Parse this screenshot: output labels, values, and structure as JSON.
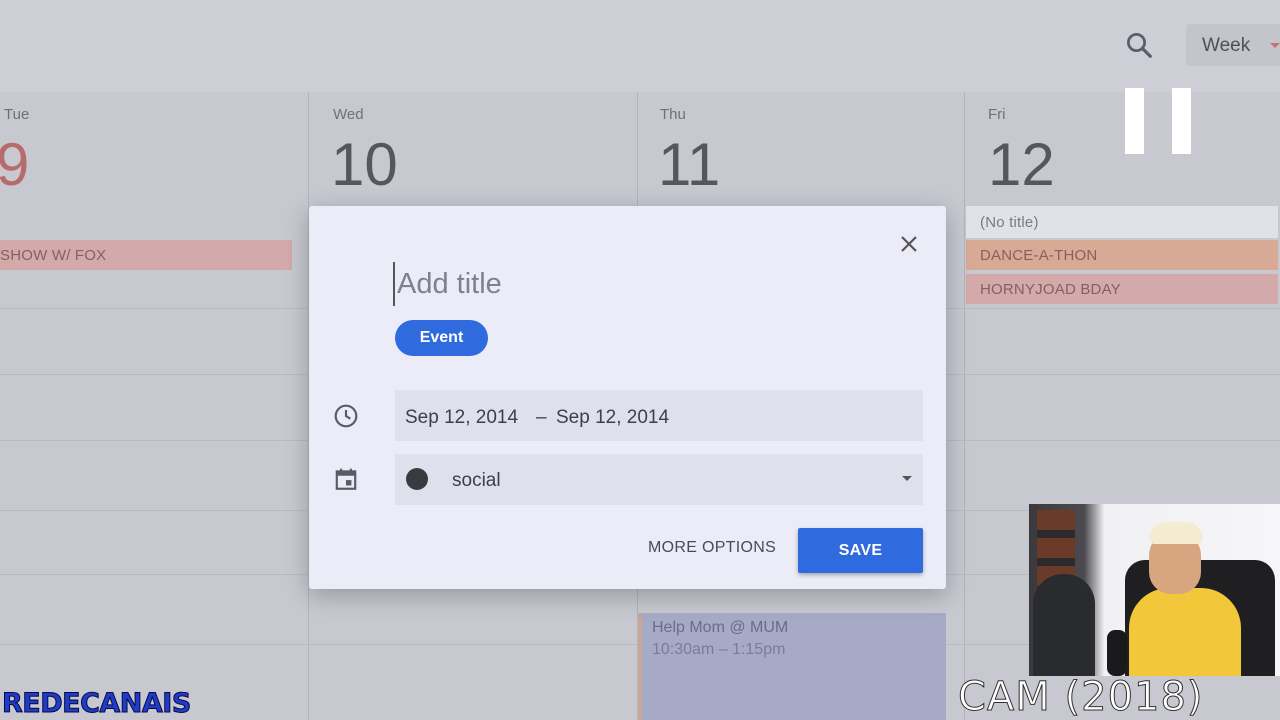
{
  "header": {
    "view_label": "Week",
    "icons": [
      "search-icon",
      "chevron-down-icon"
    ]
  },
  "days": [
    {
      "dow": "Tue",
      "num": "9"
    },
    {
      "dow": "Wed",
      "num": "10"
    },
    {
      "dow": "Thu",
      "num": "11"
    },
    {
      "dow": "Fri",
      "num": "12"
    }
  ],
  "events": {
    "fox": "SHOW W/ FOX",
    "no_title": "(No title)",
    "dance": "DANCE-A-THON",
    "horny": "HORNYJOAD BDAY",
    "help_title": "Help Mom @ MUM",
    "help_time": "10:30am – 1:15pm"
  },
  "dialog": {
    "title_placeholder": "Add title",
    "chip_label": "Event",
    "date_start": "Sep 12, 2014",
    "date_sep": "–",
    "date_end": "Sep 12, 2014",
    "calendar_name": "social",
    "more_options_label": "MORE OPTIONS",
    "save_label": "SAVE",
    "icons": [
      "close-icon",
      "clock-icon",
      "calendar-icon",
      "pause-icon"
    ]
  },
  "colors": {
    "accent_blue": "#2f6bdf",
    "event_red": "#d3a9a9",
    "event_orange": "#d8aa95",
    "event_purple": "#a7aac4"
  },
  "overlays": {
    "watermark_left": "REDECANAIS",
    "watermark_right": "CAM (2018)"
  }
}
